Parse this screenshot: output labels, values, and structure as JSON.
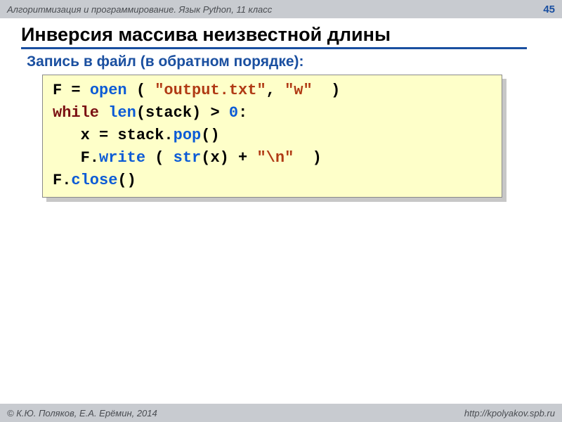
{
  "header": {
    "course": "Алгоритмизация и программирование. Язык Python, 11 класс",
    "page": "45"
  },
  "title": "Инверсия массива неизвестной длины",
  "subhead": "Запись в файл (в обратном порядке):",
  "code": {
    "l1": {
      "a": "F = ",
      "open": "open",
      "b": " ( ",
      "s1": "\"output.txt\"",
      "c": ", ",
      "s2": "\"w\"",
      "d": "  )"
    },
    "l2": {
      "while": "while",
      "sp": " ",
      "len": "len",
      "a": "(stack) > ",
      "zero": "0",
      "b": ":"
    },
    "l3": {
      "a": "   x = stack.",
      "pop": "pop",
      "b": "()"
    },
    "l4": {
      "a": "   F.",
      "write": "write",
      "b": " ( ",
      "str": "str",
      "c": "(x) + ",
      "nl": "\"\\n\"",
      "d": "  )"
    },
    "l5": {
      "a": "F.",
      "close": "close",
      "b": "()"
    }
  },
  "footer": {
    "authors": "© К.Ю. Поляков, Е.А. Ерёмин, 2014",
    "url": "http://kpolyakov.spb.ru"
  }
}
